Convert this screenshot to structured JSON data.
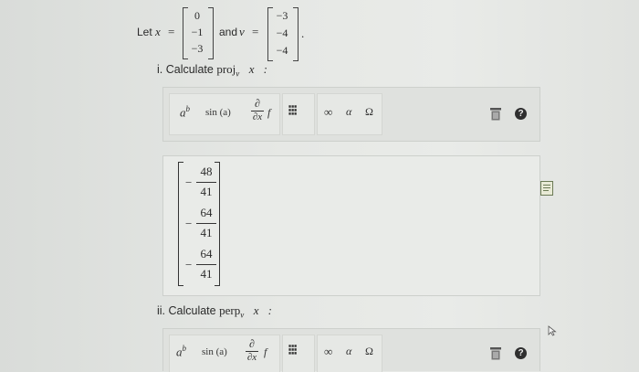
{
  "problem": {
    "let_label": "Let",
    "x_symbol": "x⃗",
    "equals": "=",
    "x_vector": [
      "0",
      "−1",
      "−3"
    ],
    "and_label": "and",
    "v_symbol": "v⃗",
    "v_vector": [
      "−3",
      "−4",
      "−4"
    ],
    "period": "."
  },
  "part1": {
    "label": "i. Calculate",
    "op": "proj",
    "sub": "v⃗",
    "arg": "x⃗:"
  },
  "part2": {
    "label": "ii. Calculate",
    "op": "perp",
    "sub": "v⃗",
    "arg": "x⃗:"
  },
  "toolbar": {
    "power_base": "a",
    "power_exp": "b",
    "sin_label": "sin (a)",
    "deriv_num": "∂",
    "deriv_den": "∂x",
    "deriv_f": "f",
    "matrix_glyph": "⁝⁝⁝",
    "infinity": "∞",
    "alpha": "α",
    "omega": "Ω",
    "help": "?"
  },
  "answer": {
    "entries": [
      {
        "sign": "−",
        "num": "48",
        "den": "41"
      },
      {
        "sign": "−",
        "num": "64",
        "den": "41"
      },
      {
        "sign": "−",
        "num": "64",
        "den": "41"
      }
    ]
  }
}
